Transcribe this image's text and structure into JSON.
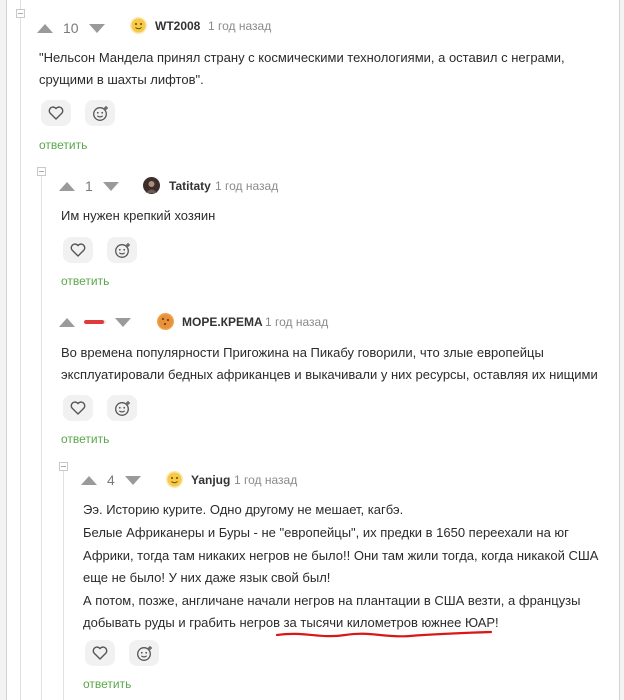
{
  "colors": {
    "reply": "#5aa64a",
    "vote_arrow": "#9a9a9a",
    "negative_bar": "#e03b3b",
    "underline": "#d81818"
  },
  "comments": [
    {
      "rating": "10",
      "author": "WT2008",
      "time": "1 год назад",
      "avatar_icon": "emoji-avatar-icon",
      "lines": [
        "\"Нельсон Мандела принял страну с космическими технологиями, а оставил с неграми,",
        "срущими в шахты лифтов\"."
      ],
      "reply": "ответить"
    },
    {
      "rating": "1",
      "author": "Tatitaty",
      "time": "1 год назад",
      "avatar_icon": "photo-avatar-icon",
      "lines": [
        "Им нужен крепкий хозяин"
      ],
      "reply": "ответить"
    },
    {
      "rating_fraction_negative": 0.9,
      "author": "МОРЕ.КРЕМА",
      "time": "1 год назад",
      "avatar_icon": "cookie-avatar-icon",
      "lines": [
        "Во времена популярности Пригожина на Пикабу говорили, что злые европейцы",
        "эксплуатировали бедных африканцев и выкачивали у них ресурсы, оставляя их нищими"
      ],
      "reply": "ответить"
    },
    {
      "rating": "4",
      "author": "Yanjug",
      "time": "1 год назад",
      "avatar_icon": "emoji-avatar-icon",
      "lines": [
        "Ээ. Историю курите. Одно другому не мешает, кагбэ.",
        "Белые Африканеры и Буры - не \"европейцы\", их предки в 1650 переехали на юг",
        "Африки, тогда там никаких негров не было!! Они там жили тогда, когда никакой США",
        "еще не было! У них даже язык свой был!",
        "А потом, позже, англичане начали негров на плантации в США везти, а французы",
        "добывать руды и грабить негров за тысячи километров южнее ЮАР!"
      ],
      "reply": "ответить"
    }
  ]
}
